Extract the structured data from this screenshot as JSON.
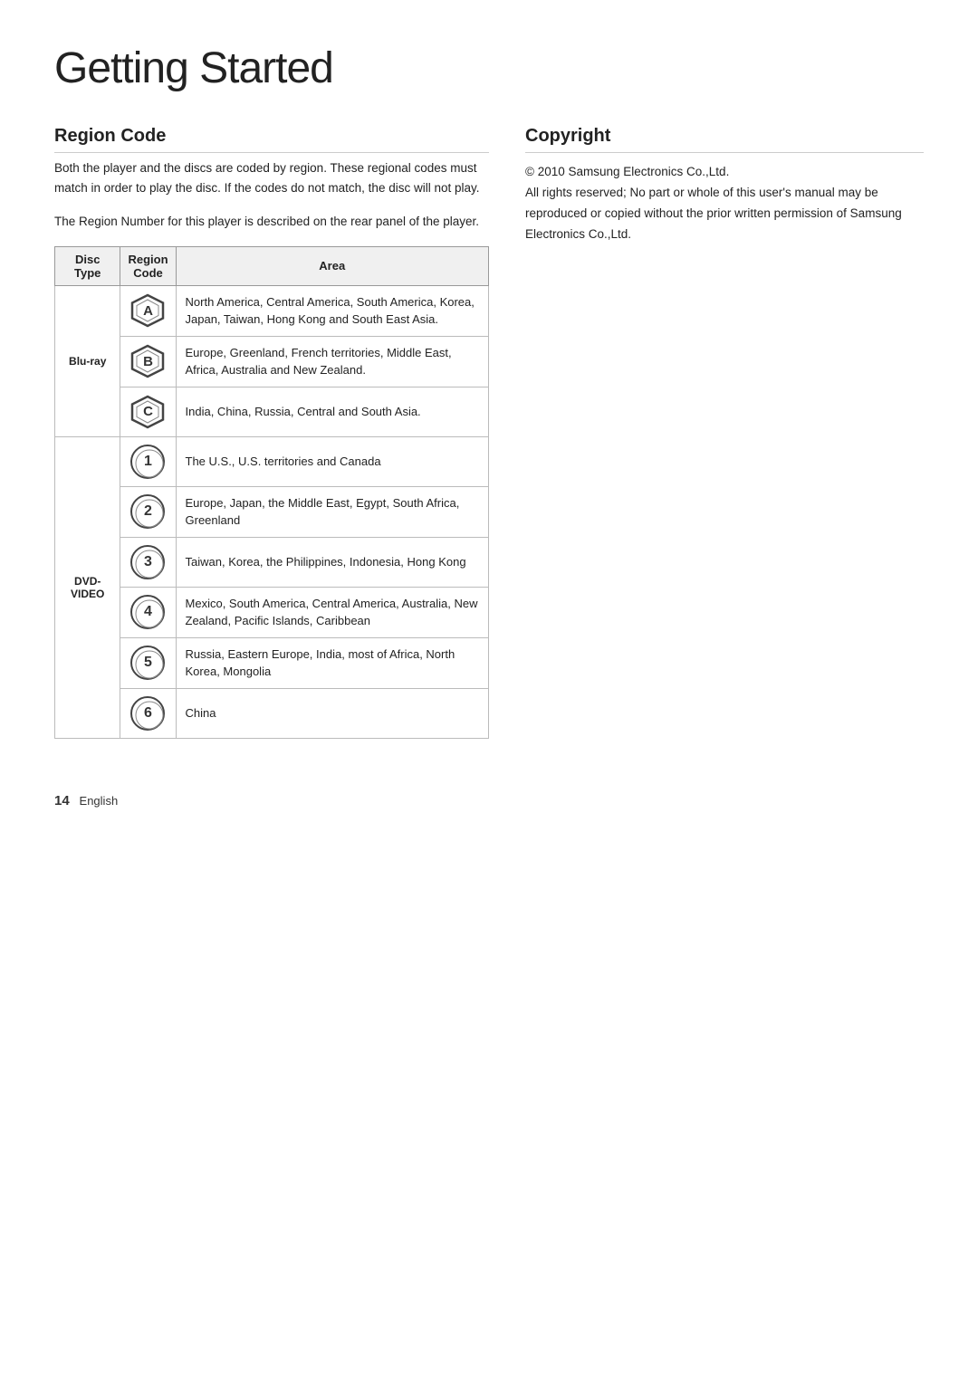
{
  "page": {
    "title": "Getting Started"
  },
  "region_code": {
    "section_title": "Region Code",
    "description1": "Both the player and the discs are coded by region. These regional codes must match in order to play the disc. If the codes do not match, the disc will not play.",
    "description2": "The Region Number for this player is described on the rear panel of the player.",
    "table": {
      "headers": [
        "Disc Type",
        "Region Code",
        "Area"
      ],
      "rows": [
        {
          "disc_type": "Blu-ray",
          "show_disc_type": true,
          "region_icon": "A",
          "icon_type": "hex",
          "area": "North America, Central America, South America, Korea, Japan, Taiwan, Hong Kong and South East Asia."
        },
        {
          "disc_type": "Blu-ray",
          "show_disc_type": false,
          "region_icon": "B",
          "icon_type": "hex",
          "area": "Europe, Greenland, French territories, Middle East, Africa, Australia and New Zealand."
        },
        {
          "disc_type": "Blu-ray",
          "show_disc_type": false,
          "region_icon": "C",
          "icon_type": "hex",
          "area": "India, China, Russia, Central and South Asia."
        },
        {
          "disc_type": "DVD-VIDEO",
          "show_disc_type": true,
          "region_icon": "1",
          "icon_type": "circle",
          "area": "The U.S., U.S. territories and Canada"
        },
        {
          "disc_type": "DVD-VIDEO",
          "show_disc_type": false,
          "region_icon": "2",
          "icon_type": "circle",
          "area": "Europe, Japan, the Middle East, Egypt, South Africa, Greenland"
        },
        {
          "disc_type": "DVD-VIDEO",
          "show_disc_type": false,
          "region_icon": "3",
          "icon_type": "circle",
          "area": "Taiwan, Korea, the Philippines, Indonesia, Hong Kong"
        },
        {
          "disc_type": "DVD-VIDEO",
          "show_disc_type": false,
          "region_icon": "4",
          "icon_type": "circle",
          "area": "Mexico, South America, Central America, Australia, New Zealand, Pacific Islands, Caribbean"
        },
        {
          "disc_type": "DVD-VIDEO",
          "show_disc_type": false,
          "region_icon": "5",
          "icon_type": "circle",
          "area": "Russia, Eastern Europe, India, most of Africa, North Korea, Mongolia"
        },
        {
          "disc_type": "DVD-VIDEO",
          "show_disc_type": false,
          "region_icon": "6",
          "icon_type": "circle",
          "area": "China"
        }
      ]
    }
  },
  "copyright": {
    "section_title": "Copyright",
    "line1": "© 2010 Samsung Electronics Co.,Ltd.",
    "line2": "All rights reserved; No part or whole of this user's manual may be reproduced or copied without the prior written permission of Samsung Electronics Co.,Ltd."
  },
  "footer": {
    "page_number": "14",
    "language": "English"
  }
}
